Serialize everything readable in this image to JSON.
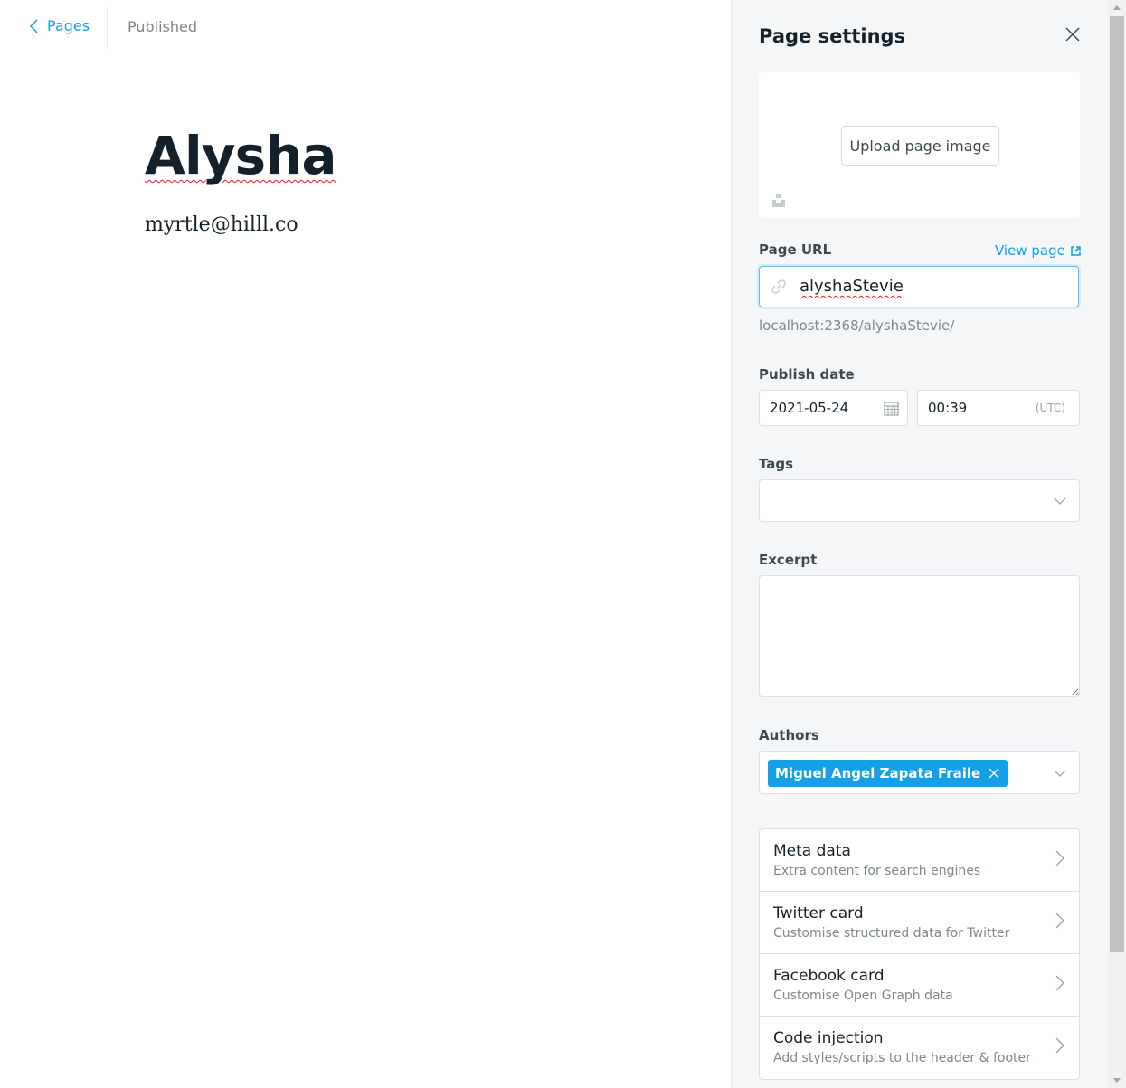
{
  "editor": {
    "back_label": "Pages",
    "status": "Published",
    "title": "Alysha",
    "body": "myrtle@hilll.co"
  },
  "settings": {
    "title": "Page settings",
    "upload_label": "Upload page image",
    "page_url_label": "Page URL",
    "view_page_label": "View page",
    "slug": "alyshaStevie",
    "url_preview": "localhost:2368/alyshaStevie/",
    "publish_date_label": "Publish date",
    "date": "2021-05-24",
    "time": "00:39",
    "timezone": "(UTC)",
    "tags_label": "Tags",
    "excerpt_label": "Excerpt",
    "excerpt_value": "",
    "authors_label": "Authors",
    "authors": [
      "Miguel Angel Zapata Fraile"
    ],
    "nav_items": [
      {
        "title": "Meta data",
        "subtitle": "Extra content for search engines"
      },
      {
        "title": "Twitter card",
        "subtitle": "Customise structured data for Twitter"
      },
      {
        "title": "Facebook card",
        "subtitle": "Customise Open Graph data"
      },
      {
        "title": "Code injection",
        "subtitle": "Add styles/scripts to the header & footer"
      }
    ]
  },
  "colors": {
    "accent": "#14a0e6",
    "panel_bg": "#f4f6f8",
    "text": "#15212a",
    "muted": "#7d878d"
  },
  "icons": {
    "back": "chevron-left-icon",
    "close": "close-icon",
    "unsplash": "unsplash-icon",
    "external": "external-link-icon",
    "link": "link-icon",
    "calendar": "calendar-icon",
    "dropdown": "chevron-down-icon",
    "nav": "chevron-right-icon",
    "remove": "remove-icon"
  }
}
